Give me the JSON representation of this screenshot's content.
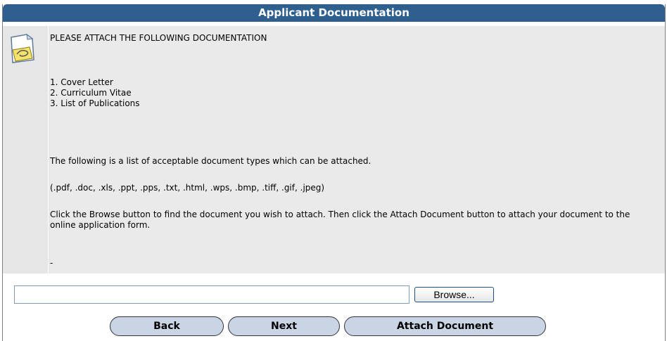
{
  "header": {
    "title": "Applicant Documentation"
  },
  "instructions": {
    "heading": "PLEASE ATTACH THE FOLLOWING DOCUMENTATION",
    "items": [
      "1. Cover Letter",
      "2. Curriculum Vitae",
      "3. List of Publications"
    ],
    "types_intro": "The following is a list of acceptable document types which can be attached.",
    "types": "(.pdf, .doc, .xls, .ppt, .pps, .txt, .html, .wps, .bmp, .tiff, .gif, .jpeg)",
    "browse_note": "Click the Browse button to find the document you wish to attach. Then click the Attach Document button to attach your document to the online application form.",
    "trailing": "-"
  },
  "upload": {
    "file_value": "",
    "browse_label": "Browse..."
  },
  "actions": {
    "back_label": "Back",
    "next_label": "Next",
    "attach_label": "Attach Document"
  },
  "icons": {
    "note": "note-paperclip-icon"
  }
}
